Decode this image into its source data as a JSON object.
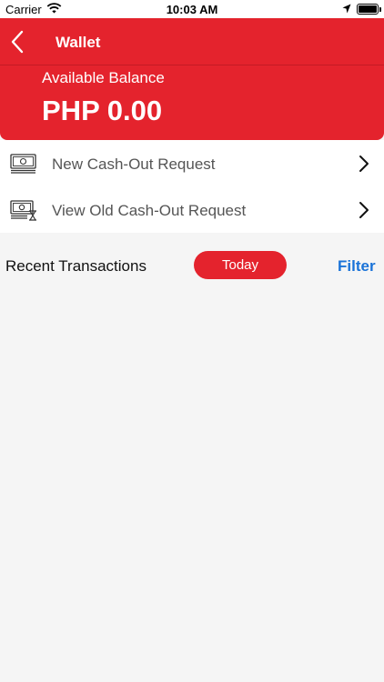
{
  "status_bar": {
    "carrier": "Carrier",
    "time": "10:03 AM",
    "icons": [
      "wifi-icon",
      "location-arrow-icon",
      "battery-icon"
    ]
  },
  "nav": {
    "title": "Wallet",
    "back_icon": "chevron-left-icon"
  },
  "balance": {
    "label": "Available Balance",
    "amount": "PHP 0.00"
  },
  "menu": [
    {
      "label": "New Cash-Out Request",
      "icon": "cash-icon"
    },
    {
      "label": "View Old Cash-Out Request",
      "icon": "cash-history-icon"
    }
  ],
  "transactions": {
    "title": "Recent Transactions",
    "period_button": "Today",
    "filter_label": "Filter"
  },
  "colors": {
    "brand_red": "#e4232d",
    "link_blue": "#1a73d8",
    "background": "#f5f5f5"
  }
}
